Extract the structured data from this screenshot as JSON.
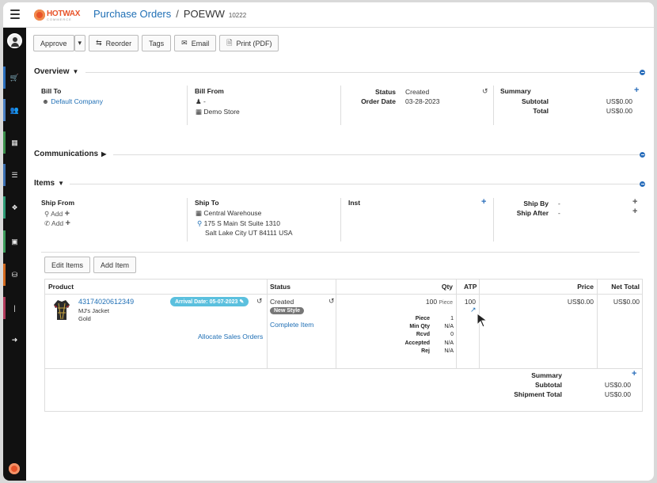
{
  "header": {
    "logo": "HOTWAX",
    "logo_sub": "COMMERCE",
    "breadcrumb_parent": "Purchase Orders",
    "breadcrumb_separator": "/",
    "breadcrumb_current": "POEWW",
    "order_number": "10222"
  },
  "toolbar": {
    "approve": "Approve",
    "reorder": "Reorder",
    "tags": "Tags",
    "email": "Email",
    "print": "Print (PDF)"
  },
  "overview": {
    "title": "Overview",
    "bill_to_label": "Bill To",
    "bill_to_value": "Default Company",
    "bill_from_label": "Bill From",
    "bill_from_person": "-",
    "bill_from_store": "Demo Store",
    "status_label": "Status",
    "status_value": "Created",
    "order_date_label": "Order Date",
    "order_date_value": "03-28-2023",
    "summary_label": "Summary",
    "subtotal_label": "Subtotal",
    "subtotal_value": "US$0.00",
    "total_label": "Total",
    "total_value": "US$0.00"
  },
  "communications": {
    "title": "Communications"
  },
  "items": {
    "title": "Items",
    "ship_from_label": "Ship From",
    "ship_from_add1": "Add",
    "ship_from_add2": "Add",
    "ship_to_label": "Ship To",
    "ship_to_name": "Central Warehouse",
    "ship_to_address1": "175 S Main St Suite 1310",
    "ship_to_address2": "Salt Lake City UT 84111 USA",
    "inst_label": "Inst",
    "ship_by_label": "Ship By",
    "ship_by_value": "-",
    "ship_after_label": "Ship After",
    "ship_after_value": "-",
    "edit_items": "Edit Items",
    "add_item": "Add Item",
    "columns": [
      "Product",
      "Status",
      "Qty",
      "ATP",
      "Price",
      "Net Total"
    ],
    "row": {
      "product_id": "43174020612349",
      "product_name": "MJ's Jacket",
      "product_variant": "Gold",
      "arrival_badge": "Arrival Date: 05-07-2023",
      "allocate_link": "Allocate Sales Orders",
      "status": "Created",
      "status_badge": "New Style",
      "complete_link": "Complete Item",
      "qty": "100",
      "qty_unit": "Piece",
      "qty_details": [
        {
          "label": "Piece",
          "value": "1"
        },
        {
          "label": "Min Qty",
          "value": "N/A"
        },
        {
          "label": "Rcvd",
          "value": "0"
        },
        {
          "label": "Accepted",
          "value": "N/A"
        },
        {
          "label": "Rej",
          "value": "N/A"
        }
      ],
      "atp": "100",
      "price": "US$0.00",
      "net_total": "US$0.00"
    },
    "summary_label": "Summary",
    "subtotal_label": "Subtotal",
    "subtotal_value": "US$0.00",
    "shipment_total_label": "Shipment Total",
    "shipment_total_value": "US$0.00"
  },
  "colors": {
    "link": "#1f6fb5",
    "accent": "#2a6ebb",
    "brand": "#e8542a",
    "badge_info": "#5bc0de",
    "badge_gray": "#777777"
  },
  "icons": [
    "menu-icon",
    "history-icon",
    "plus-icon",
    "user-icon",
    "store-icon",
    "map-marker-icon",
    "phone-icon",
    "pencil-icon",
    "external-link-icon",
    "refresh-icon",
    "envelope-icon",
    "file-pdf-icon"
  ]
}
